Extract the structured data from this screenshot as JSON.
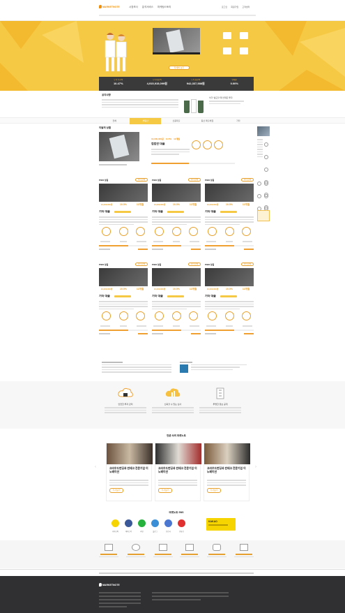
{
  "header": {
    "logo_text": "MARKETNOTE",
    "nav": [
      "시장조사",
      "분석서비스",
      "마케팅스토리"
    ],
    "util": [
      "로그인",
      "회원가입",
      "고객센터"
    ]
  },
  "hero": {
    "button_label": "자세히 보기",
    "stats": [
      {
        "label": "누적 투자액",
        "value": "10.47%"
      },
      {
        "label": "누적 대출액",
        "value": "4,915,915,099원"
      },
      {
        "label": "누적 상환액",
        "value": "942,337,588원"
      },
      {
        "label": "연체율",
        "value": "0.00%"
      }
    ]
  },
  "notice": {
    "title": "공지사항",
    "promo": "차가 필요할 때 언제든 투자"
  },
  "tabs": [
    "전체",
    "부동산",
    "신용대출",
    "동산·매출채권",
    "기타"
  ],
  "featured": {
    "section_title": "이달의 상품",
    "product_title": "컴컴한 대출",
    "stats": [
      "10,000,000원",
      "11.5%",
      "12개월"
    ]
  },
  "cards": [
    {
      "label": "PIED 상품",
      "badge": "이미 판매",
      "title": "기타 대출",
      "amount": "10,000,000원",
      "rate": "10.5%",
      "term": "12개월"
    },
    {
      "label": "PIED 상품",
      "badge": "이미 판매",
      "title": "기타 대출",
      "amount": "10,000,000원",
      "rate": "10.5%",
      "term": "12개월"
    },
    {
      "label": "PIED 상품",
      "badge": "이미 판매",
      "title": "기타 대출",
      "amount": "10,000,000원",
      "rate": "10.5%",
      "term": "12개월"
    },
    {
      "label": "PIED 상품",
      "badge": "이미 판매",
      "title": "기타 대출",
      "amount": "10,000,000원",
      "rate": "10.5%",
      "term": "12개월"
    },
    {
      "label": "PIED 상품",
      "badge": "이미 판매",
      "title": "기타 대출",
      "amount": "10,000,000원",
      "rate": "10.5%",
      "term": "12개월"
    },
    {
      "label": "PIED 상품",
      "badge": "이미 판매",
      "title": "기타 대출",
      "amount": "10,000,000원",
      "rate": "10.5%",
      "term": "12개월"
    }
  ],
  "features": [
    {
      "title": "안전한 투자 관리"
    },
    {
      "title": "신뢰할 수 있는 심사"
    },
    {
      "title": "투명한 정보 공개"
    }
  ],
  "news": {
    "section_title": "언론 속의 마켓노트",
    "items": [
      {
        "title": "크라우드펀딩과 핀테크 전문기업 이노베이션"
      },
      {
        "title": "크라우드펀딩과 핀테크 전문기업 이노베이션"
      },
      {
        "title": "크라우드펀딩과 핀테크 전문기업 이노베이션"
      }
    ],
    "button_label": "기사보기"
  },
  "sns": {
    "section_title": "마켓노트 SNS",
    "items": [
      "카카오톡",
      "페이스북",
      "라인",
      "블로그",
      "인스타",
      "유튜브"
    ],
    "banner_text": "KAKAO"
  },
  "footer": {
    "logo_text": "MARKETNOTE"
  },
  "colors": {
    "accent": "#f0900a",
    "hero_bg": "#f6c944",
    "footer_bg": "#303033"
  }
}
